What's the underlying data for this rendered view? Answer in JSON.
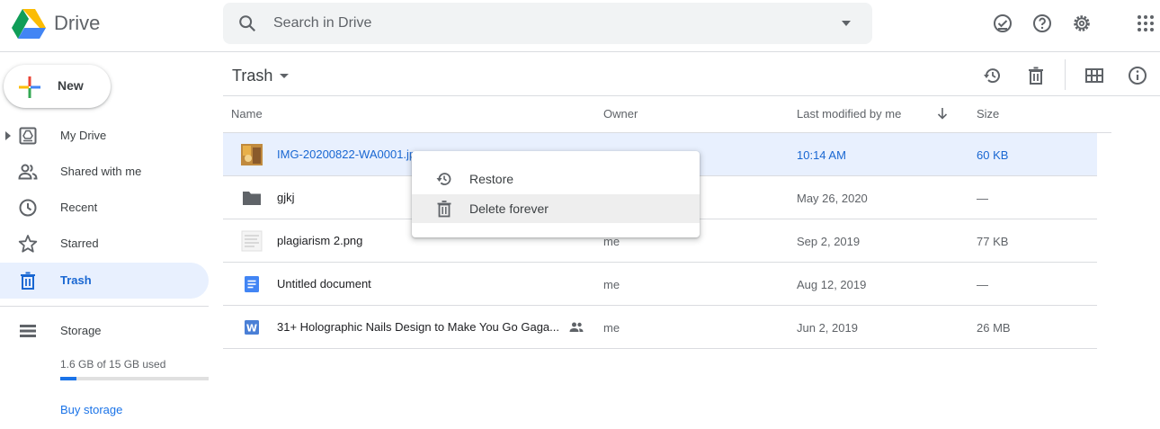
{
  "header": {
    "brand": "Drive",
    "search_placeholder": "Search in Drive"
  },
  "sidebar": {
    "new_label": "New",
    "items": [
      {
        "label": "My Drive",
        "icon": "my-drive-icon"
      },
      {
        "label": "Shared with me",
        "icon": "shared-icon"
      },
      {
        "label": "Recent",
        "icon": "clock-icon"
      },
      {
        "label": "Starred",
        "icon": "star-icon"
      },
      {
        "label": "Trash",
        "icon": "trash-icon",
        "active": true
      }
    ],
    "storage": {
      "label": "Storage",
      "used_text": "1.6 GB of 15 GB used",
      "used_fraction": 0.107,
      "buy_label": "Buy storage"
    }
  },
  "main": {
    "breadcrumb": "Trash",
    "columns": {
      "name": "Name",
      "owner": "Owner",
      "modified": "Last modified by me",
      "size": "Size"
    },
    "rows": [
      {
        "name": "IMG-20200822-WA0001.jpg",
        "owner": "",
        "modified": "10:14 AM",
        "size": "60 KB",
        "type": "image",
        "selected": true
      },
      {
        "name": "gjkj",
        "owner": "",
        "modified": "May 26, 2020",
        "size": "—",
        "type": "folder"
      },
      {
        "name": "plagiarism 2.png",
        "owner": "me",
        "modified": "Sep 2, 2019",
        "size": "77 KB",
        "type": "png"
      },
      {
        "name": "Untitled document",
        "owner": "me",
        "modified": "Aug 12, 2019",
        "size": "—",
        "type": "doc"
      },
      {
        "name": "31+ Holographic Nails Design to Make You Go Gaga...",
        "owner": "me",
        "modified": "Jun 2, 2019",
        "size": "26 MB",
        "type": "word",
        "shared": true
      }
    ]
  },
  "context_menu": {
    "items": [
      {
        "label": "Restore",
        "icon": "restore-icon"
      },
      {
        "label": "Delete forever",
        "icon": "delete-icon",
        "hover": true
      }
    ]
  },
  "colors": {
    "accent": "#1a73e8",
    "selected_bg": "#e8f0fe",
    "selected_text": "#1967d2"
  }
}
